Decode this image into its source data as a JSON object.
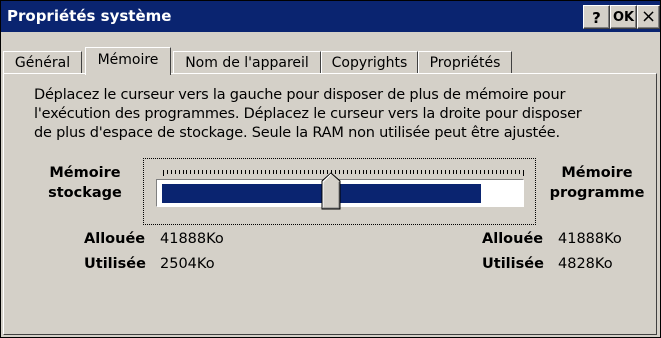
{
  "window": {
    "title": "Propriétés système",
    "help_button": "?",
    "ok_button": "OK",
    "close_button": "×"
  },
  "tabs": [
    {
      "label": "Général",
      "active": false
    },
    {
      "label": "Mémoire",
      "active": true
    },
    {
      "label": "Nom de l'appareil",
      "active": false
    },
    {
      "label": "Copyrights",
      "active": false
    },
    {
      "label": "Propriétés",
      "active": false
    }
  ],
  "memory": {
    "description_lines": [
      "Déplacez le curseur vers la gauche pour disposer de plus de mémoire pour",
      "l'exécution des programmes. Déplacez le curseur vers la droite pour disposer",
      "de plus d'espace de stockage. Seule la RAM non utilisée peut être ajustée."
    ],
    "storage_label_line1": "Mémoire",
    "storage_label_line2": "stockage",
    "program_label_line1": "Mémoire",
    "program_label_line2": "programme",
    "slider_fraction": 0.48,
    "storage": {
      "allocated_label": "Allouée",
      "allocated_value": "41888Ko",
      "used_label": "Utilisée",
      "used_value": "2504Ko"
    },
    "program": {
      "allocated_label": "Allouée",
      "allocated_value": "41888Ko",
      "used_label": "Utilisée",
      "used_value": "4828Ko"
    }
  },
  "colors": {
    "titlebar": "#0a2470",
    "face": "#d4d0c8",
    "slider_fill": "#0a2470"
  }
}
